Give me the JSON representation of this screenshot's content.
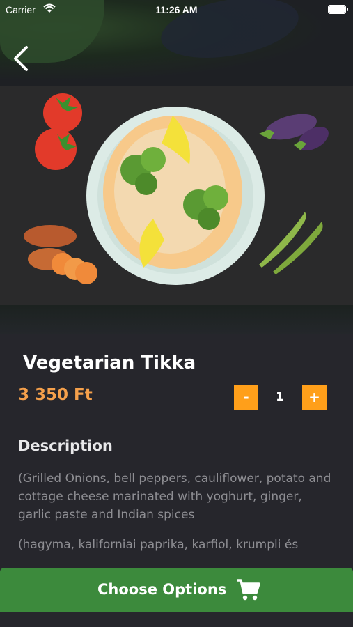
{
  "status_bar": {
    "carrier": "Carrier",
    "time": "11:26 AM"
  },
  "product": {
    "title": "Vegetarian Tikka",
    "price": "3 350 Ft",
    "quantity": "1",
    "minus_label": "-",
    "plus_label": "+"
  },
  "description": {
    "heading": "Description",
    "text_en": "(Grilled Onions, bell peppers, cauliflower, potato and cottage cheese marinated with yoghurt, ginger, garlic paste and Indian spices",
    "text_hu": "(hagyma, kaliforniai paprika, karfiol, krumpli és"
  },
  "cta": {
    "label": "Choose Options"
  },
  "colors": {
    "accent": "#ff9f1a",
    "price": "#f5a04b",
    "cta": "#3c8a3c",
    "background": "#26262c"
  }
}
